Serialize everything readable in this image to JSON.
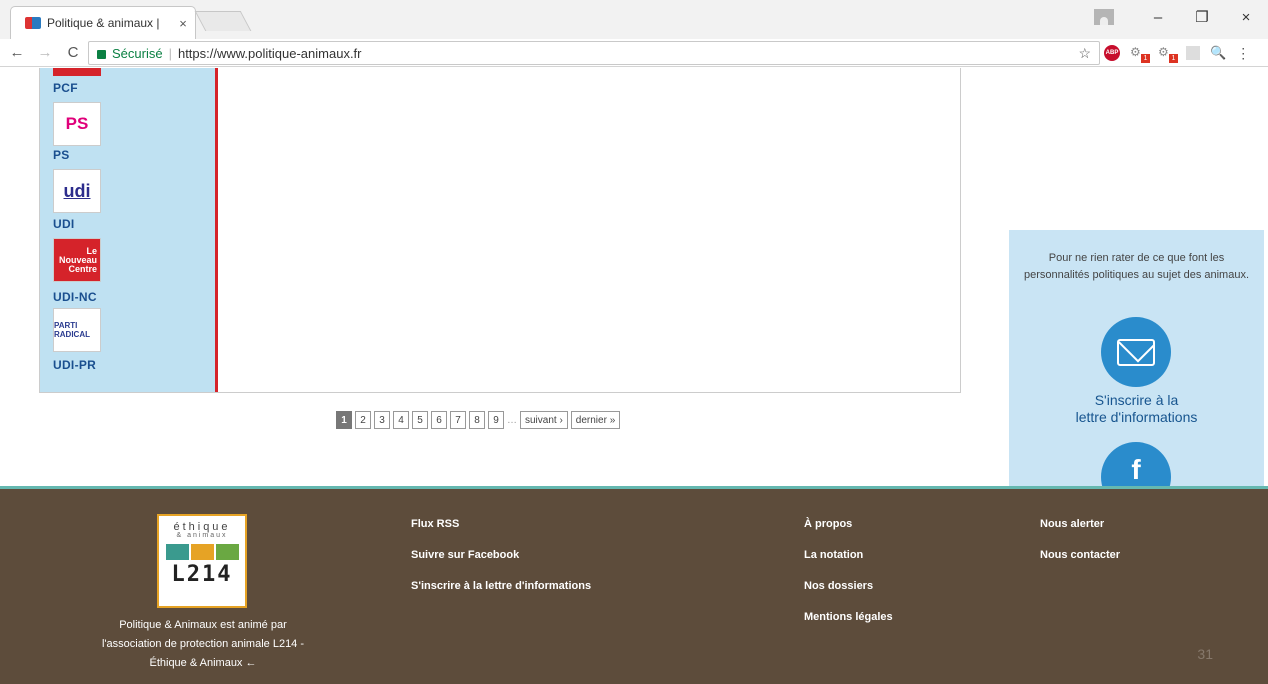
{
  "browser": {
    "tab_title": "Politique & animaux |",
    "tab_close": "×",
    "security_label": "Sécurisé",
    "url": "https://www.politique-animaux.fr",
    "window_controls": [
      "–",
      "❐",
      "×"
    ],
    "bookmark_star": "☆",
    "extensions": {
      "abp_label": "ABP",
      "badge_1": "1",
      "badge_2": "1"
    }
  },
  "parties": [
    {
      "name": "PCF",
      "logo_text": ""
    },
    {
      "name": "PS",
      "logo_text": "PS"
    },
    {
      "name": "UDI",
      "logo_text": "udi"
    },
    {
      "name": "UDI-NC",
      "logo_text": "Le Nouveau Centre"
    },
    {
      "name": "UDI-PR",
      "logo_text": "PARTI RADICAL"
    }
  ],
  "pager": {
    "pages": [
      "1",
      "2",
      "3",
      "4",
      "5",
      "6",
      "7",
      "8",
      "9"
    ],
    "current": "1",
    "ellipsis": "…",
    "next_label": "suivant ›",
    "last_label": "dernier »"
  },
  "sidebar": {
    "intro": "Pour ne rien rater de ce que font les personnalités politiques au sujet des animaux.",
    "subscribe_line1": "S'inscrire à la",
    "subscribe_line2": "lettre d'informations",
    "fb_glyph": "f"
  },
  "footer": {
    "logo_top": "éthique",
    "logo_sub": "& animaux",
    "logo_code": "L214",
    "description": "Politique & Animaux est animé par l'association de protection animale L214 - Éthique & Animaux ←",
    "col1": [
      "Flux RSS",
      "Suivre sur Facebook",
      "S'inscrire à la lettre d'informations"
    ],
    "col2": [
      "À propos",
      "La notation",
      "Nos dossiers",
      "Mentions légales"
    ],
    "col3": [
      "Nous alerter",
      "Nous contacter"
    ],
    "page_number": "31"
  },
  "colors": {
    "party_column": "#bfe1f2",
    "accent_red": "#d5232a",
    "footer_bg": "#5d4c3b",
    "footer_border": "#65b8b0",
    "circle_blue": "#2a8ccc"
  }
}
